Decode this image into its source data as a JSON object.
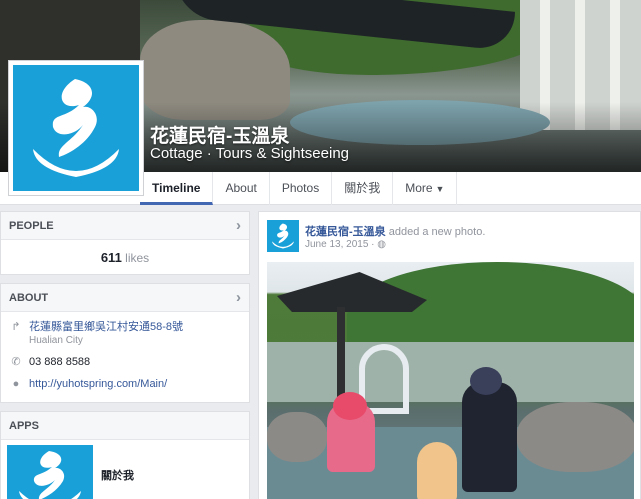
{
  "page": {
    "name": "花蓮民宿-玉溫泉",
    "category": "Cottage · Tours & Sightseeing"
  },
  "nav": {
    "tabs": [
      {
        "label": "Timeline",
        "active": true
      },
      {
        "label": "About",
        "active": false
      },
      {
        "label": "Photos",
        "active": false
      },
      {
        "label": "關於我",
        "active": false
      },
      {
        "label": "More",
        "active": false
      }
    ]
  },
  "people": {
    "heading": "PEOPLE",
    "likes_count": "611",
    "likes_label": "likes"
  },
  "about": {
    "heading": "ABOUT",
    "address": "花蓮縣富里鄉吳江村安通58-8號",
    "city": "Hualian City",
    "phone": "03 888 8588",
    "website": "http://yuhotspring.com/Main/"
  },
  "apps": {
    "heading": "APPS",
    "item_label": "關於我"
  },
  "post": {
    "author": "花蓮民宿-玉溫泉",
    "action": "added a new photo.",
    "date": "June 13, 2015",
    "privacy_icon": "globe-icon"
  },
  "colors": {
    "brand_blue": "#1aa0d8",
    "link": "#365899",
    "tab_underline": "#4267b2"
  }
}
